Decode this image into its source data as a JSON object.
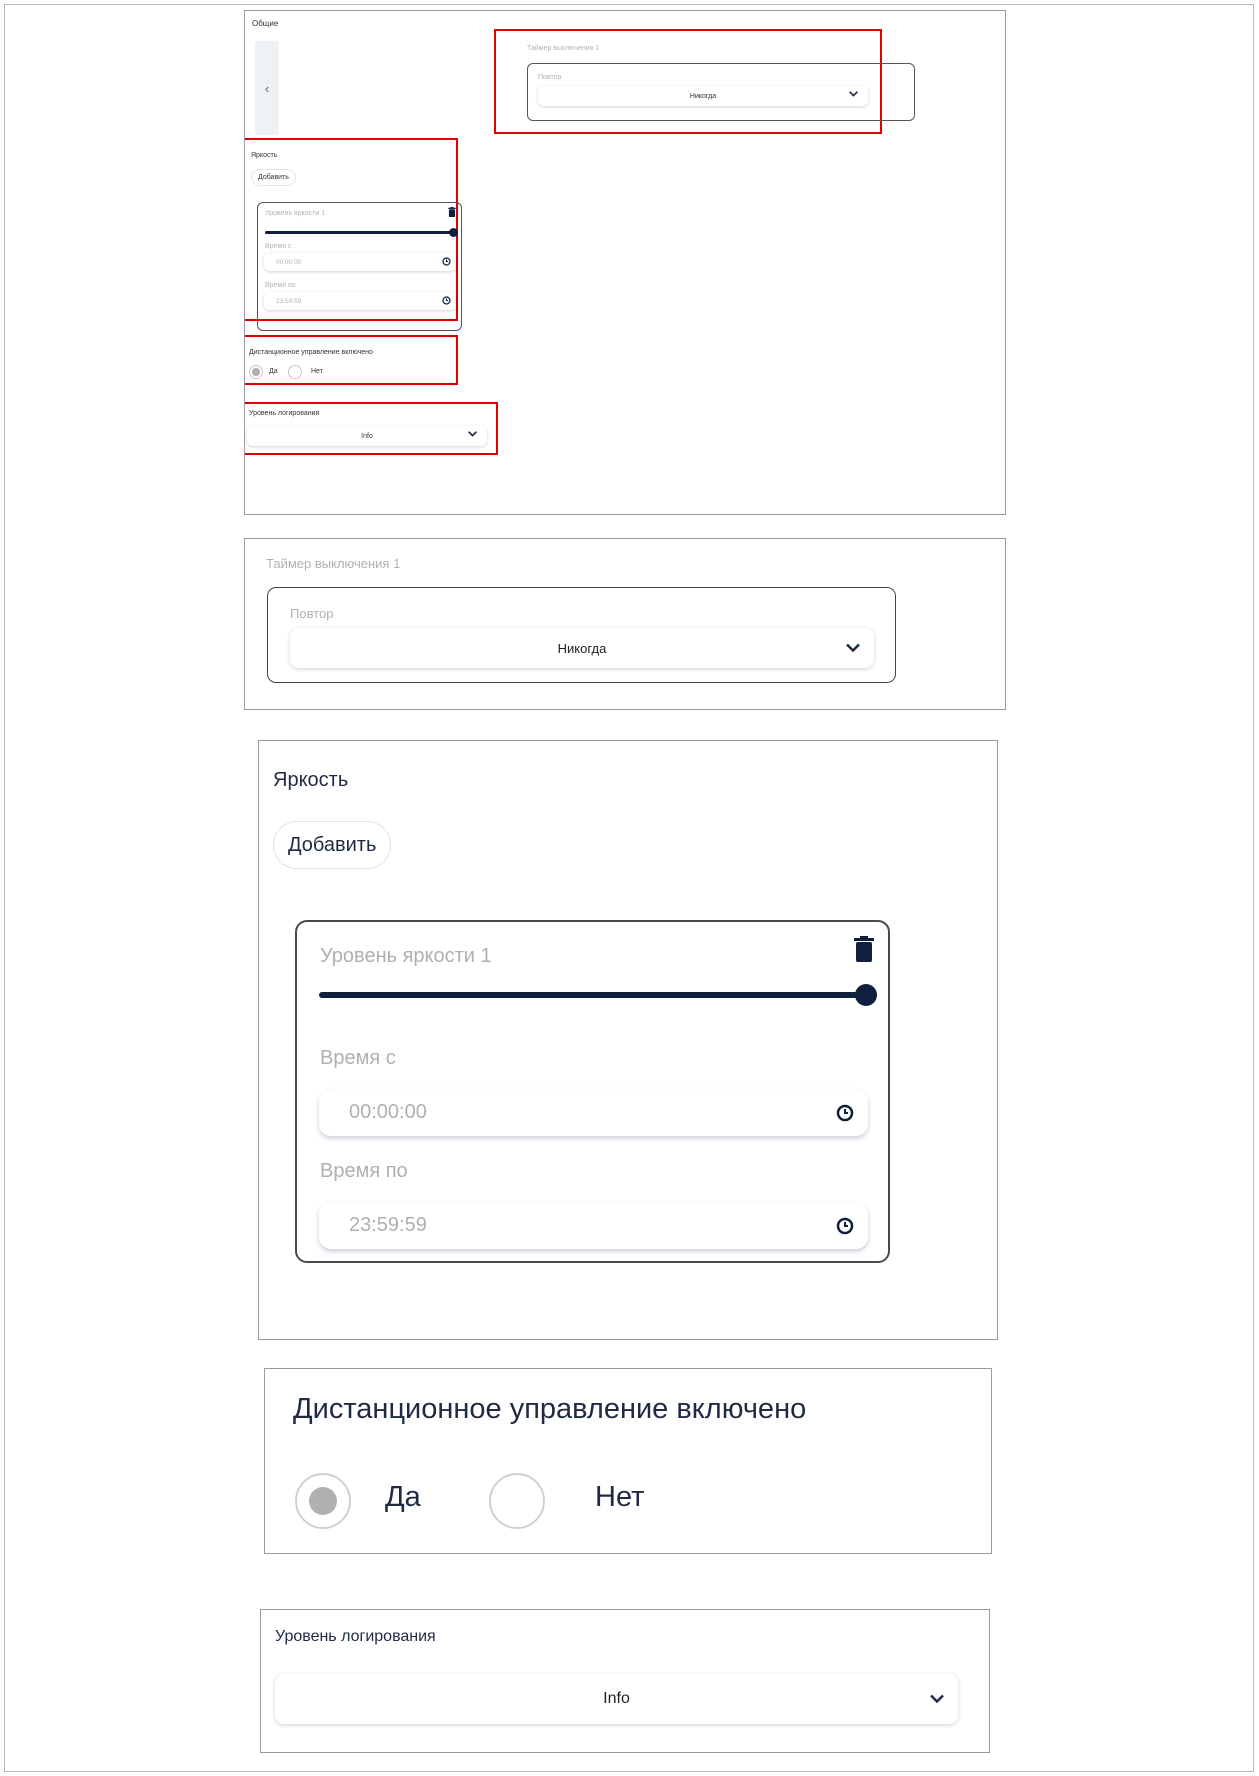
{
  "overview": {
    "section_title": "Общие",
    "back_glyph": "‹"
  },
  "timer": {
    "title": "Таймер выключения 1",
    "repeat_label": "Повтор",
    "repeat_value": "Никогда"
  },
  "brightness": {
    "title": "Яркость",
    "add_label": "Добавить",
    "level_label": "Уровень яркости 1",
    "level_value_fraction": 1.0,
    "time_from_label": "Время с",
    "time_from_value": "00:00:00",
    "time_to_label": "Время по",
    "time_to_value": "23:59:59"
  },
  "remote": {
    "title": "Дистанционное управление включено",
    "option_yes": "Да",
    "option_no": "Нет",
    "selected": "Да"
  },
  "logging": {
    "title": "Уровень логирования",
    "value": "Info"
  },
  "colors": {
    "highlight": "#e00000",
    "accent": "#0f1f3d",
    "muted_text": "#b0b0b0"
  },
  "icons": [
    "chevron-left-icon",
    "chevron-down-icon",
    "trash-icon",
    "clock-icon"
  ]
}
